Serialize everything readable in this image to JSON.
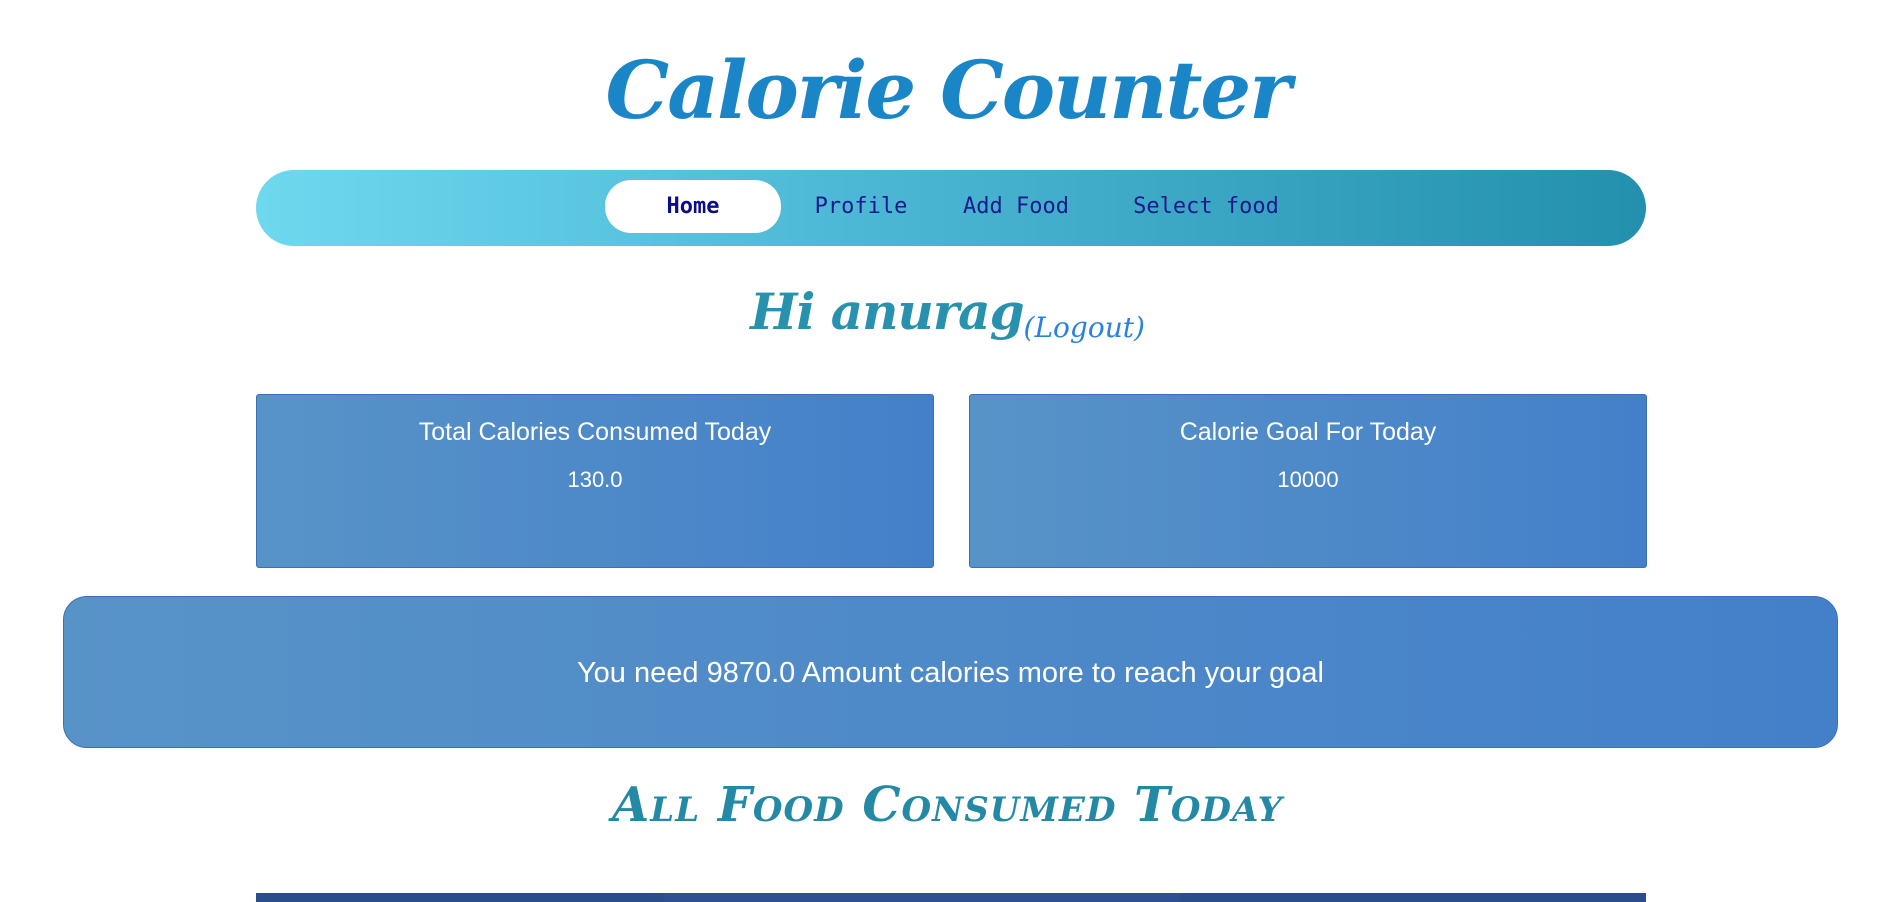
{
  "app": {
    "title": "Calorie Counter"
  },
  "nav": {
    "items": [
      {
        "label": "Home",
        "active": true
      },
      {
        "label": "Profile",
        "active": false
      },
      {
        "label": "Add Food",
        "active": false
      },
      {
        "label": "Select food",
        "active": false
      }
    ]
  },
  "greeting": {
    "text": "Hi anurag",
    "logout_label": "(Logout)"
  },
  "stats": {
    "consumed_title": "Total Calories Consumed Today",
    "consumed_value": "130.0",
    "goal_title": "Calorie Goal For Today",
    "goal_value": "10000"
  },
  "remaining": {
    "message": "You need 9870.0 Amount calories more to reach your goal"
  },
  "section": {
    "title": "All Food Consumed Today"
  },
  "colors": {
    "title": "#1a86c8",
    "nav_start": "#6ed8ef",
    "nav_end": "#2390ae",
    "card_start": "#5893c8",
    "card_end": "#4480c9",
    "section_title": "#2389a4",
    "table_header": "#2c4f8c"
  }
}
